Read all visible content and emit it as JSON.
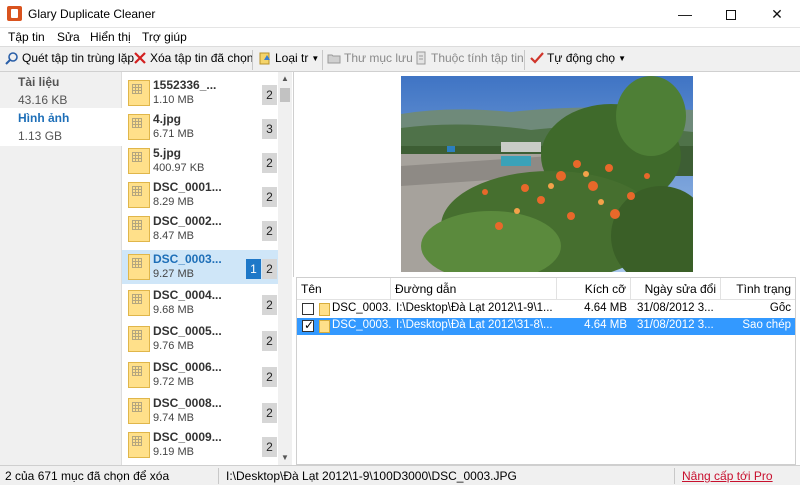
{
  "window": {
    "title": "Glary Duplicate Cleaner",
    "minimize": "—",
    "close": "✕"
  },
  "menu": [
    "Tập tin",
    "Sửa",
    "Hiển thị",
    "Trợ giúp"
  ],
  "toolbar": {
    "scan": "Quét tập tin trùng lặp",
    "delete": "Xóa tập tin đã chọn",
    "type": "Loại tr",
    "folder": "Thư mục lưu",
    "properties": "Thuộc tính tập tin",
    "auto": "Tự động chọ"
  },
  "categories": [
    {
      "name": "Tài liệu",
      "size": "43.16 KB"
    },
    {
      "name": "Hình ảnh",
      "size": "1.13 GB"
    }
  ],
  "files": [
    {
      "name": "1552336_...",
      "size": "1.10 MB",
      "count": "2",
      "selected": ""
    },
    {
      "name": "4.jpg",
      "size": "6.71 MB",
      "count": "3",
      "selected": ""
    },
    {
      "name": "5.jpg",
      "size": "400.97 KB",
      "count": "2",
      "selected": ""
    },
    {
      "name": "DSC_0001...",
      "size": "8.29 MB",
      "count": "2",
      "selected": ""
    },
    {
      "name": "DSC_0002...",
      "size": "8.47 MB",
      "count": "2",
      "selected": ""
    },
    {
      "name": "DSC_0003...",
      "size": "9.27 MB",
      "count": "2",
      "selected": "1"
    },
    {
      "name": "DSC_0004...",
      "size": "9.68 MB",
      "count": "2",
      "selected": ""
    },
    {
      "name": "DSC_0005...",
      "size": "9.76 MB",
      "count": "2",
      "selected": ""
    },
    {
      "name": "DSC_0006...",
      "size": "9.72 MB",
      "count": "2",
      "selected": ""
    },
    {
      "name": "DSC_0008...",
      "size": "9.74 MB",
      "count": "2",
      "selected": ""
    },
    {
      "name": "DSC_0009...",
      "size": "9.19 MB",
      "count": "2",
      "selected": ""
    }
  ],
  "table": {
    "headers": {
      "name": "Tên",
      "path": "Đường dẫn",
      "size": "Kích cỡ",
      "modified": "Ngày sửa đổi",
      "status": "Tình trạng"
    },
    "rows": [
      {
        "name": "DSC_0003...",
        "path": "I:\\Desktop\\Đà Lạt 2012\\1-9\\1...",
        "size": "4.64 MB",
        "modified": "31/08/2012 3...",
        "status": "Gốc"
      },
      {
        "name": "DSC_0003...",
        "path": "I:\\Desktop\\Đà Lạt 2012\\31-8\\...",
        "size": "4.64 MB",
        "modified": "31/08/2012 3...",
        "status": "Sao chép"
      }
    ]
  },
  "status": {
    "selection": "2 của 671 mục đã chọn để xóa",
    "path": "I:\\Desktop\\Đà Lạt 2012\\1-9\\100D3000\\DSC_0003.JPG",
    "upgrade": "Nâng cấp tới Pro"
  }
}
